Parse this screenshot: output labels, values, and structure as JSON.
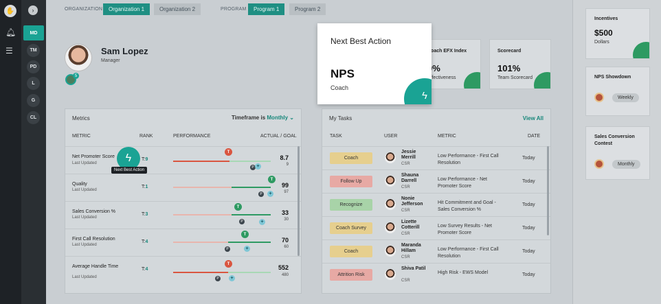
{
  "nav": {
    "rail_items": [
      "MD",
      "TM",
      "PD",
      "L",
      "G",
      "CL"
    ]
  },
  "topbar": {
    "organization_label": "ORGANIZATION",
    "org_tabs": [
      "Organization 1",
      "Organization 2"
    ],
    "program_label": "PROGRAM",
    "program_tabs": [
      "Program 1",
      "Program 2"
    ]
  },
  "profile": {
    "name": "Sam Lopez",
    "role": "Manager",
    "badge_count": "5"
  },
  "next_best_action": {
    "title": "Next Best Action",
    "metric": "NPS",
    "action": "Coach"
  },
  "scorecards": [
    {
      "title": "Coach EFX Index",
      "value": "0%",
      "sub": "Effectiveness"
    },
    {
      "title": "Scorecard",
      "value": "101%",
      "sub": "Team Scorecard"
    }
  ],
  "metrics": {
    "title": "Metrics",
    "timeframe_label": "Timeframe is",
    "timeframe_value": "Monthly",
    "headers": {
      "metric": "METRIC",
      "rank": "RANK",
      "performance": "PERFORMANCE",
      "actual_goal": "ACTUAL / GOAL"
    },
    "tooltip": "Next Best Action",
    "rows": [
      {
        "name": "Net Promoter Score",
        "updated": "Last Updated",
        "rank_prefix": "T:",
        "rank": "9",
        "actual": "8.7",
        "goal": "9"
      },
      {
        "name": "Quality",
        "updated": "Last Updated",
        "rank_prefix": "T:",
        "rank": "1",
        "actual": "99",
        "goal": "97"
      },
      {
        "name": "Sales Conversion %",
        "updated": "Last Updated",
        "rank_prefix": "T:",
        "rank": "3",
        "actual": "33",
        "goal": "30"
      },
      {
        "name": "First Call Resolution",
        "updated": "Last Updated",
        "rank_prefix": "T:",
        "rank": "4",
        "actual": "70",
        "goal": "60"
      },
      {
        "name": "Average Handle Time",
        "updated": "Last Updated",
        "rank_prefix": "T:",
        "rank": "4",
        "actual": "552",
        "goal": "480"
      }
    ]
  },
  "tasks": {
    "title": "My Tasks",
    "view_all": "View All",
    "headers": {
      "task": "TASK",
      "user": "USER",
      "metric": "METRIC",
      "date": "DATE"
    },
    "rows": [
      {
        "task": "Coach",
        "user": "Jessie Merrill",
        "role": "CSR",
        "metric": "Low Performance - First Call Resolution",
        "date": "Today",
        "color": "#e6cf8e"
      },
      {
        "task": "Follow Up",
        "user": "Shauna Darrell",
        "role": "CSR",
        "metric": "Low Performance - Net Promoter Score",
        "date": "Today",
        "color": "#e7a9a4"
      },
      {
        "task": "Recognize",
        "user": "Nonie Jefferson",
        "role": "CSR",
        "metric": "Hit Commitment and Goal - Sales Conversion %",
        "date": "Today",
        "color": "#a8d3a8"
      },
      {
        "task": "Coach Survey",
        "user": "Lizette Cotterill",
        "role": "CSR",
        "metric": "Low Survey Results - Net Promoter Score",
        "date": "Today",
        "color": "#e6cf8e"
      },
      {
        "task": "Coach",
        "user": "Maranda Hillam",
        "role": "CSR",
        "metric": "Low Performance - First Call Resolution",
        "date": "Today",
        "color": "#e6cf8e"
      },
      {
        "task": "Attrition Risk",
        "user": "Shiva Patil",
        "role": "CSR",
        "metric": "High Risk - EWS Model",
        "date": "Today",
        "color": "#e7a9a4"
      }
    ]
  },
  "right": {
    "incentives": {
      "title": "Incentives",
      "value": "$500",
      "sub": "Dollars"
    },
    "nps_showdown": {
      "title": "NPS Showdown",
      "period": "Weekly"
    },
    "sales_contest": {
      "title": "Sales Conversion Contest",
      "period": "Monthly"
    }
  },
  "colors": {
    "accent": "#1aa394",
    "green": "#2e9a62",
    "red": "#d9553f"
  }
}
